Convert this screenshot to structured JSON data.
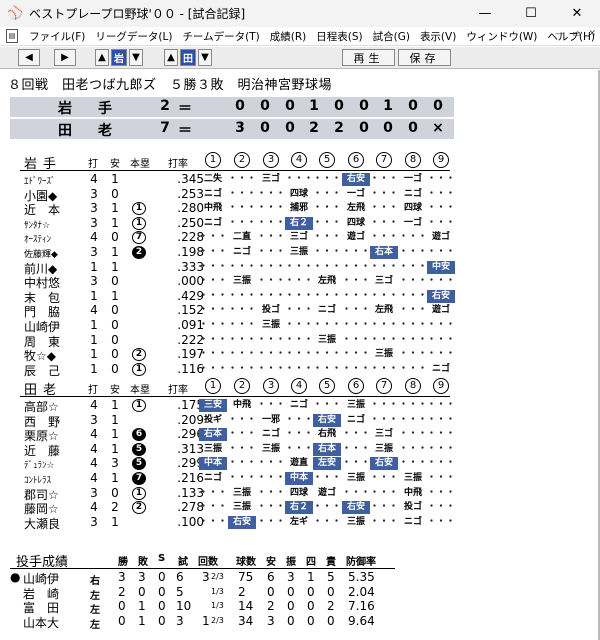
{
  "window": {
    "app_icon": "baseball-cap-icon",
    "title": "ベストプレープロ野球'００ - [試合記録]",
    "controls": [
      "—",
      "☐",
      "✕"
    ]
  },
  "menu": {
    "items": [
      "ファイル(F)",
      "リーグデータ(L)",
      "チームデータ(T)",
      "成績(R)",
      "日程表(S)",
      "試合(G)",
      "表示(V)",
      "ウィンドウ(W)",
      "ヘルプ(H)"
    ],
    "mdi_controls": [
      "—",
      "▭",
      "✕"
    ]
  },
  "toolbar": {
    "team_away": "岩",
    "team_home": "田",
    "play": "再生",
    "save": "保存"
  },
  "game": {
    "info": "８回戦　田老つば九郎ズ　５勝３敗　明治神宮野球場"
  },
  "scoreboard": [
    {
      "team": "岩　手",
      "total": "2",
      "eq": "＝",
      "innings": [
        "0",
        "0",
        "0",
        "1",
        "0",
        "0",
        "1",
        "0",
        "0"
      ]
    },
    {
      "team": "田　老",
      "total": "7",
      "eq": "＝",
      "innings": [
        "3",
        "0",
        "0",
        "2",
        "2",
        "0",
        "0",
        "0",
        "×"
      ]
    }
  ],
  "headers": {
    "ab": "打",
    "h": "安",
    "hr": "本塁",
    "avg": "打率",
    "innings": [
      "1",
      "2",
      "3",
      "4",
      "5",
      "6",
      "7",
      "8",
      "9"
    ]
  },
  "away": {
    "team": "岩手",
    "batters": [
      {
        "name": "ｴﾄﾞﾜｰｽﾞ",
        "small": true,
        "ab": "4",
        "h": "1",
        "hr": "",
        "hr_filled": false,
        "avg": ".345",
        "cells": [
          {
            "t": "二失"
          },
          {
            "t": "dots"
          },
          {
            "t": "三ゴ"
          },
          {
            "t": "dots"
          },
          {
            "t": "dots"
          },
          {
            "t": "右安",
            "hit": true
          },
          {
            "t": "dots"
          },
          {
            "t": "一ゴ"
          },
          {
            "t": "dots"
          }
        ]
      },
      {
        "name": "小園◆",
        "ab": "3",
        "h": "0",
        "hr": "",
        "hr_filled": false,
        "avg": ".253",
        "cells": [
          {
            "t": "ニゴ"
          },
          {
            "t": "dots"
          },
          {
            "t": "dots"
          },
          {
            "t": "四球"
          },
          {
            "t": "dots"
          },
          {
            "t": "一ゴ"
          },
          {
            "t": "dots"
          },
          {
            "t": "ニゴ"
          },
          {
            "t": "dots"
          }
        ]
      },
      {
        "name": "近　本",
        "ab": "3",
        "h": "1",
        "hr": "1",
        "hr_filled": false,
        "avg": ".280",
        "cells": [
          {
            "t": "中飛"
          },
          {
            "t": "dots"
          },
          {
            "t": "dots"
          },
          {
            "t": "捕邪"
          },
          {
            "t": "dots"
          },
          {
            "t": "左飛"
          },
          {
            "t": "dots"
          },
          {
            "t": "四球"
          },
          {
            "t": "dots"
          }
        ]
      },
      {
        "name": "ｻﾝﾀﾅ☆",
        "small": true,
        "ab": "3",
        "h": "1",
        "hr": "1",
        "hr_filled": false,
        "avg": ".250",
        "cells": [
          {
            "t": "ニゴ"
          },
          {
            "t": "dots"
          },
          {
            "t": "dots"
          },
          {
            "t": "右２",
            "hit": true
          },
          {
            "t": "dots"
          },
          {
            "t": "四球"
          },
          {
            "t": "dots"
          },
          {
            "t": "一ゴ"
          },
          {
            "t": "dots"
          }
        ]
      },
      {
        "name": "ｵｰｽﾃｨﾝ",
        "small": true,
        "ab": "4",
        "h": "0",
        "hr": "7",
        "hr_filled": false,
        "avg": ".228",
        "cells": [
          {
            "t": "dots"
          },
          {
            "t": "二直"
          },
          {
            "t": "dots"
          },
          {
            "t": "三ゴ"
          },
          {
            "t": "dots"
          },
          {
            "t": "遊ゴ"
          },
          {
            "t": "dots"
          },
          {
            "t": "dots"
          },
          {
            "t": "遊ゴ"
          }
        ]
      },
      {
        "name": "佐藤輝◆",
        "small": true,
        "ab": "3",
        "h": "1",
        "hr": "2",
        "hr_filled": true,
        "avg": ".198",
        "cells": [
          {
            "t": "dots"
          },
          {
            "t": "ニゴ"
          },
          {
            "t": "dots"
          },
          {
            "t": "三振"
          },
          {
            "t": "dots"
          },
          {
            "t": "dots"
          },
          {
            "t": "右本",
            "hit": true
          },
          {
            "t": "dots"
          },
          {
            "t": "dots"
          }
        ]
      },
      {
        "name": "前川◆",
        "ab": "1",
        "h": "1",
        "hr": "",
        "hr_filled": false,
        "avg": ".333",
        "cells": [
          {
            "t": "dots"
          },
          {
            "t": "dots"
          },
          {
            "t": "dots"
          },
          {
            "t": "dots"
          },
          {
            "t": "dots"
          },
          {
            "t": "dots"
          },
          {
            "t": "dots"
          },
          {
            "t": "dots"
          },
          {
            "t": "中安",
            "hit": true
          }
        ]
      },
      {
        "name": "中村悠",
        "ab": "3",
        "h": "0",
        "hr": "",
        "hr_filled": false,
        "avg": ".000",
        "cells": [
          {
            "t": "dots"
          },
          {
            "t": "三振"
          },
          {
            "t": "dots"
          },
          {
            "t": "dots"
          },
          {
            "t": "左飛"
          },
          {
            "t": "dots"
          },
          {
            "t": "三ゴ"
          },
          {
            "t": "dots"
          },
          {
            "t": "dots"
          }
        ]
      },
      {
        "name": "末　包",
        "ab": "1",
        "h": "1",
        "hr": "",
        "hr_filled": false,
        "avg": ".429",
        "cells": [
          {
            "t": "dots"
          },
          {
            "t": "dots"
          },
          {
            "t": "dots"
          },
          {
            "t": "dots"
          },
          {
            "t": "dots"
          },
          {
            "t": "dots"
          },
          {
            "t": "dots"
          },
          {
            "t": "dots"
          },
          {
            "t": "右安",
            "hit": true
          }
        ]
      },
      {
        "name": "門　脇",
        "ab": "4",
        "h": "0",
        "hr": "",
        "hr_filled": false,
        "avg": ".152",
        "cells": [
          {
            "t": "dots"
          },
          {
            "t": "dots"
          },
          {
            "t": "投ゴ"
          },
          {
            "t": "dots"
          },
          {
            "t": "ニゴ"
          },
          {
            "t": "dots"
          },
          {
            "t": "左飛"
          },
          {
            "t": "dots"
          },
          {
            "t": "遊ゴ"
          }
        ]
      },
      {
        "name": "山崎伊",
        "ab": "1",
        "h": "0",
        "hr": "",
        "hr_filled": false,
        "avg": ".091",
        "cells": [
          {
            "t": "dots"
          },
          {
            "t": "dots"
          },
          {
            "t": "三振"
          },
          {
            "t": "dots"
          },
          {
            "t": "dots"
          },
          {
            "t": "dots"
          },
          {
            "t": "dots"
          },
          {
            "t": "dots"
          },
          {
            "t": "dots"
          }
        ]
      },
      {
        "name": "周　東",
        "ab": "1",
        "h": "0",
        "hr": "",
        "hr_filled": false,
        "avg": ".222",
        "cells": [
          {
            "t": "dots"
          },
          {
            "t": "dots"
          },
          {
            "t": "dots"
          },
          {
            "t": "dots"
          },
          {
            "t": "三振"
          },
          {
            "t": "dots"
          },
          {
            "t": "dots"
          },
          {
            "t": "dots"
          },
          {
            "t": "dots"
          }
        ]
      },
      {
        "name": "牧☆◆",
        "ab": "1",
        "h": "0",
        "hr": "2",
        "hr_filled": false,
        "avg": ".197",
        "cells": [
          {
            "t": "dots"
          },
          {
            "t": "dots"
          },
          {
            "t": "dots"
          },
          {
            "t": "dots"
          },
          {
            "t": "dots"
          },
          {
            "t": "dots"
          },
          {
            "t": "三振"
          },
          {
            "t": "dots"
          },
          {
            "t": "dots"
          }
        ]
      },
      {
        "name": "辰　己",
        "ab": "1",
        "h": "0",
        "hr": "1",
        "hr_filled": false,
        "avg": ".116",
        "cells": [
          {
            "t": "dots"
          },
          {
            "t": "dots"
          },
          {
            "t": "dots"
          },
          {
            "t": "dots"
          },
          {
            "t": "dots"
          },
          {
            "t": "dots"
          },
          {
            "t": "dots"
          },
          {
            "t": "dots"
          },
          {
            "t": "ニゴ"
          }
        ]
      }
    ]
  },
  "home": {
    "team": "田老",
    "batters": [
      {
        "name": "高部☆",
        "ab": "4",
        "h": "1",
        "hr": "1",
        "hr_filled": false,
        "avg": ".175",
        "cells": [
          {
            "t": "三安",
            "hit": true
          },
          {
            "t": "中飛"
          },
          {
            "t": "dots"
          },
          {
            "t": "ニゴ"
          },
          {
            "t": "dots"
          },
          {
            "t": "三振"
          },
          {
            "t": "dots"
          },
          {
            "t": "dots"
          },
          {
            "t": "dots"
          }
        ]
      },
      {
        "name": "西　野",
        "ab": "3",
        "h": "1",
        "hr": "",
        "hr_filled": false,
        "avg": ".209",
        "cells": [
          {
            "t": "投ギ"
          },
          {
            "t": "dots"
          },
          {
            "t": "一邪"
          },
          {
            "t": "dots"
          },
          {
            "t": "右安",
            "hit": true
          },
          {
            "t": "ニゴ"
          },
          {
            "t": "dots"
          },
          {
            "t": "dots"
          },
          {
            "t": "dots"
          }
        ]
      },
      {
        "name": "栗原☆",
        "ab": "4",
        "h": "1",
        "hr": "6",
        "hr_filled": true,
        "avg": ".296",
        "cells": [
          {
            "t": "右本",
            "hit": true
          },
          {
            "t": "dots"
          },
          {
            "t": "ニゴ"
          },
          {
            "t": "dots"
          },
          {
            "t": "右飛"
          },
          {
            "t": "dots"
          },
          {
            "t": "三ゴ"
          },
          {
            "t": "dots"
          },
          {
            "t": "dots"
          }
        ]
      },
      {
        "name": "近　藤",
        "ab": "4",
        "h": "1",
        "hr": "5",
        "hr_filled": true,
        "avg": ".313",
        "cells": [
          {
            "t": "三振"
          },
          {
            "t": "dots"
          },
          {
            "t": "三振"
          },
          {
            "t": "dots"
          },
          {
            "t": "右本",
            "hit": true
          },
          {
            "t": "dots"
          },
          {
            "t": "三振"
          },
          {
            "t": "dots"
          },
          {
            "t": "dots"
          }
        ]
      },
      {
        "name": "ﾃﾞｭﾗﾝ☆",
        "small": true,
        "ab": "4",
        "h": "3",
        "hr": "5",
        "hr_filled": true,
        "avg": ".299",
        "cells": [
          {
            "t": "中本",
            "hit": true
          },
          {
            "t": "dots"
          },
          {
            "t": "dots"
          },
          {
            "t": "遊直"
          },
          {
            "t": "左安",
            "hit": true
          },
          {
            "t": "dots"
          },
          {
            "t": "右安",
            "hit": true
          },
          {
            "t": "dots"
          },
          {
            "t": "dots"
          }
        ]
      },
      {
        "name": "ｺﾝﾄﾚﾗｽ",
        "small": true,
        "ab": "4",
        "h": "1",
        "hr": "7",
        "hr_filled": true,
        "avg": ".216",
        "cells": [
          {
            "t": "ニゴ"
          },
          {
            "t": "dots"
          },
          {
            "t": "dots"
          },
          {
            "t": "中本",
            "hit": true
          },
          {
            "t": "dots"
          },
          {
            "t": "三振"
          },
          {
            "t": "dots"
          },
          {
            "t": "三振"
          },
          {
            "t": "dots"
          }
        ]
      },
      {
        "name": "郡司☆",
        "ab": "3",
        "h": "0",
        "hr": "1",
        "hr_filled": false,
        "avg": ".133",
        "cells": [
          {
            "t": "dots"
          },
          {
            "t": "三振"
          },
          {
            "t": "dots"
          },
          {
            "t": "四球"
          },
          {
            "t": "遊ゴ"
          },
          {
            "t": "dots"
          },
          {
            "t": "dots"
          },
          {
            "t": "中飛"
          },
          {
            "t": "dots"
          }
        ]
      },
      {
        "name": "藤岡☆",
        "ab": "4",
        "h": "2",
        "hr": "2",
        "hr_filled": false,
        "avg": ".278",
        "cells": [
          {
            "t": "dots"
          },
          {
            "t": "三振"
          },
          {
            "t": "dots"
          },
          {
            "t": "右２",
            "hit": true
          },
          {
            "t": "dots"
          },
          {
            "t": "右安",
            "hit": true
          },
          {
            "t": "dots"
          },
          {
            "t": "投ゴ"
          },
          {
            "t": "dots"
          }
        ]
      },
      {
        "name": "大瀬良",
        "ab": "3",
        "h": "1",
        "hr": "",
        "hr_filled": false,
        "avg": ".100",
        "cells": [
          {
            "t": "dots"
          },
          {
            "t": "右安",
            "hit": true
          },
          {
            "t": "dots"
          },
          {
            "t": "左ギ"
          },
          {
            "t": "dots"
          },
          {
            "t": "三振"
          },
          {
            "t": "dots"
          },
          {
            "t": "ニゴ"
          },
          {
            "t": "dots"
          }
        ]
      }
    ]
  },
  "pitching": {
    "title": "投手成績",
    "headers": {
      "w": "勝",
      "l": "敗",
      "s": "S",
      "g": "試",
      "ip": "回数",
      "pitches": "球数",
      "h": "安",
      "k": "振",
      "bb": "四",
      "er": "責",
      "era": "防御率"
    },
    "rows": [
      {
        "mark": "●",
        "name": "山崎伊",
        "hand": "右",
        "w": "3",
        "l": "3",
        "s": "0",
        "g": "6",
        "ip_whole": "3",
        "ip_frac": "2/3",
        "pitches": "75",
        "h": "6",
        "k": "3",
        "bb": "1",
        "er": "5",
        "era": "5.35"
      },
      {
        "mark": "",
        "name": "岩　崎",
        "hand": "左",
        "w": "2",
        "l": "0",
        "s": "0",
        "g": "5",
        "ip_whole": "",
        "ip_frac": "1/3",
        "pitches": "2",
        "h": "0",
        "k": "0",
        "bb": "0",
        "er": "0",
        "era": "2.04"
      },
      {
        "mark": "",
        "name": "富　田",
        "hand": "左",
        "w": "0",
        "l": "1",
        "s": "0",
        "g": "10",
        "ip_whole": "",
        "ip_frac": "1/3",
        "pitches": "14",
        "h": "2",
        "k": "0",
        "bb": "0",
        "er": "2",
        "era": "7.16"
      },
      {
        "mark": "",
        "name": "山本大",
        "hand": "左",
        "w": "0",
        "l": "1",
        "s": "0",
        "g": "3",
        "ip_whole": "1",
        "ip_frac": "2/3",
        "pitches": "34",
        "h": "3",
        "k": "0",
        "bb": "0",
        "er": "0",
        "era": "9.64"
      }
    ]
  }
}
